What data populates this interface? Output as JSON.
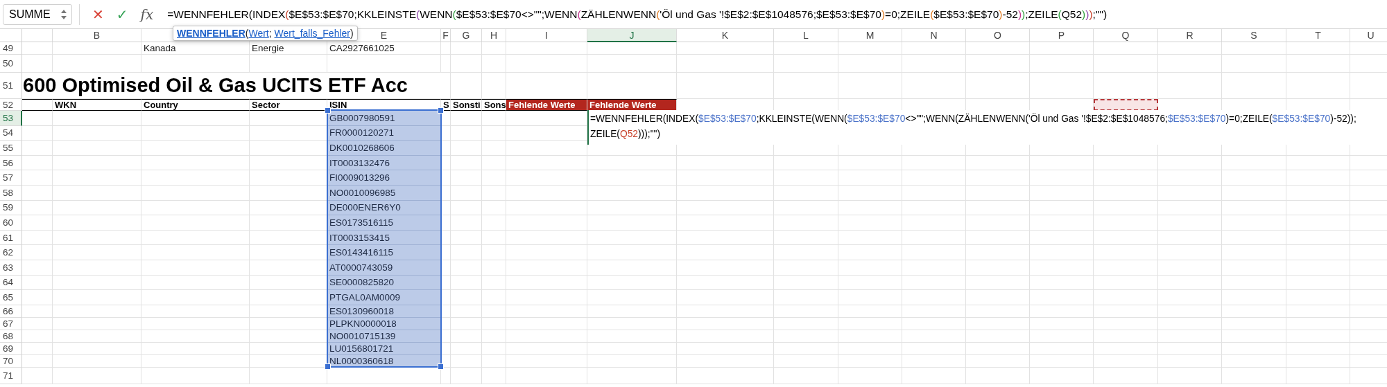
{
  "name_box": {
    "value": "SUMME"
  },
  "formula_bar": {
    "cancel": "✕",
    "confirm": "✓",
    "function_button": "fx",
    "segments": [
      {
        "text": "=WENNFEHLER(INDEX",
        "color": "#000000"
      },
      {
        "text": "(",
        "color": "#c8412a"
      },
      {
        "text": "$E$53:$E$70;KKLEINSTE",
        "color": "#000000"
      },
      {
        "text": "(",
        "color": "#8e44ad"
      },
      {
        "text": "WENN",
        "color": "#000000"
      },
      {
        "text": "(",
        "color": "#2e9e3e"
      },
      {
        "text": "$E$53:$E$70<>\"\";WENN",
        "color": "#000000"
      },
      {
        "text": "(",
        "color": "#c2338f"
      },
      {
        "text": "ZÄHLENWENN",
        "color": "#000000"
      },
      {
        "text": "(",
        "color": "#e07b22"
      },
      {
        "text": "'Öl und Gas '!$E$2:$E$1048576;$E$53:$E$70",
        "color": "#000000"
      },
      {
        "text": ")",
        "color": "#e07b22"
      },
      {
        "text": "=0;ZEILE",
        "color": "#000000"
      },
      {
        "text": "(",
        "color": "#e07b22"
      },
      {
        "text": "$E$53:$E$70",
        "color": "#000000"
      },
      {
        "text": ")",
        "color": "#e07b22"
      },
      {
        "text": "-52",
        "color": "#000000"
      },
      {
        "text": ")",
        "color": "#c2338f"
      },
      {
        "text": ")",
        "color": "#2e9e3e"
      },
      {
        "text": ";ZEILE",
        "color": "#000000"
      },
      {
        "text": "(",
        "color": "#2e9e3e"
      },
      {
        "text": "Q52",
        "color": "#000000"
      },
      {
        "text": ")",
        "color": "#2e9e3e"
      },
      {
        "text": ")",
        "color": "#8e44ad"
      },
      {
        "text": ")",
        "color": "#c8412a"
      },
      {
        "text": ";\"\")",
        "color": "#000000"
      }
    ]
  },
  "tooltip": {
    "function": "WENNFEHLER",
    "open": "(",
    "args": [
      "Wert",
      "Wert_falls_Fehler"
    ],
    "separator": "; ",
    "close": ")"
  },
  "column_headers": [
    {
      "label": "B",
      "selected": false
    },
    {
      "selected": false
    },
    {
      "selected": false
    },
    {
      "label": "E",
      "selected": false
    },
    {
      "label": "F",
      "selected": false
    },
    {
      "label": "G",
      "selected": false
    },
    {
      "label": "H",
      "selected": false
    },
    {
      "label": "I",
      "selected": false
    },
    {
      "label": "J",
      "selected": true
    },
    {
      "label": "K",
      "selected": false
    },
    {
      "label": "L",
      "selected": false
    },
    {
      "label": "M",
      "selected": false
    },
    {
      "label": "N",
      "selected": false
    },
    {
      "label": "O",
      "selected": false
    },
    {
      "label": "P",
      "selected": false
    },
    {
      "label": "Q",
      "selected": false
    },
    {
      "label": "R",
      "selected": false
    },
    {
      "label": "S",
      "selected": false
    },
    {
      "label": "T",
      "selected": false
    },
    {
      "label": "U",
      "selected": false
    }
  ],
  "rows": [
    {
      "number": "49",
      "selected": false,
      "cells": {
        "c": {
          "text": "Kanada"
        },
        "d": {
          "text": "Energie"
        },
        "e": {
          "text": "CA2927661025"
        }
      }
    },
    {
      "number": "50",
      "selected": false,
      "cells": {}
    },
    {
      "number": "51",
      "selected": false,
      "cells": {
        "a": {
          "text": "600 Optimised Oil & Gas UCITS ETF Acc",
          "kind": "title"
        }
      }
    },
    {
      "number": "52",
      "selected": false,
      "cells": {
        "b": {
          "text": "WKN",
          "kind": "header"
        },
        "c": {
          "text": "Country",
          "kind": "header"
        },
        "d": {
          "text": "Sector",
          "kind": "header"
        },
        "e": {
          "text": "ISIN",
          "kind": "header"
        },
        "f": {
          "text": "S",
          "kind": "header"
        },
        "g": {
          "text": "Sonsti",
          "kind": "header"
        },
        "h": {
          "text": "Sons",
          "kind": "header"
        },
        "i": {
          "text": "Fehlende Werte",
          "kind": "missing"
        },
        "j": {
          "text": "Fehlende Werte",
          "kind": "missing"
        },
        "q": {
          "kind": "copy-range"
        }
      }
    },
    {
      "number": "53",
      "selected": true,
      "cells": {
        "e": {
          "text": "GB0007980591",
          "selected": true
        }
      }
    },
    {
      "number": "54",
      "selected": false,
      "cells": {
        "e": {
          "text": "FR0000120271",
          "selected": true
        }
      }
    },
    {
      "number": "55",
      "selected": false,
      "cells": {
        "e": {
          "text": "DK0010268606",
          "selected": true
        }
      }
    },
    {
      "number": "56",
      "selected": false,
      "cells": {
        "e": {
          "text": "IT0003132476",
          "selected": true
        }
      }
    },
    {
      "number": "57",
      "selected": false,
      "cells": {
        "e": {
          "text": "FI0009013296",
          "selected": true
        }
      }
    },
    {
      "number": "58",
      "selected": false,
      "cells": {
        "e": {
          "text": "NO0010096985",
          "selected": true
        }
      }
    },
    {
      "number": "59",
      "selected": false,
      "cells": {
        "e": {
          "text": "DE000ENER6Y0",
          "selected": true
        }
      }
    },
    {
      "number": "60",
      "selected": false,
      "cells": {
        "e": {
          "text": "ES0173516115",
          "selected": true
        }
      }
    },
    {
      "number": "61",
      "selected": false,
      "cells": {
        "e": {
          "text": "IT0003153415",
          "selected": true
        }
      }
    },
    {
      "number": "62",
      "selected": false,
      "cells": {
        "e": {
          "text": "ES0143416115",
          "selected": true
        }
      }
    },
    {
      "number": "63",
      "selected": false,
      "cells": {
        "e": {
          "text": "AT0000743059",
          "selected": true
        }
      }
    },
    {
      "number": "64",
      "selected": false,
      "cells": {
        "e": {
          "text": "SE0000825820",
          "selected": true
        }
      }
    },
    {
      "number": "65",
      "selected": false,
      "cells": {
        "e": {
          "text": "PTGAL0AM0009",
          "selected": true
        }
      }
    },
    {
      "number": "66",
      "selected": false,
      "cells": {
        "e": {
          "text": "ES0130960018",
          "selected": true
        }
      }
    },
    {
      "number": "67",
      "selected": false,
      "cells": {
        "e": {
          "text": "PLPKN0000018",
          "selected": true
        }
      }
    },
    {
      "number": "68",
      "selected": false,
      "cells": {
        "e": {
          "text": "NO0010715139",
          "selected": true
        }
      }
    },
    {
      "number": "69",
      "selected": false,
      "cells": {
        "e": {
          "text": "LU0156801721",
          "selected": true
        }
      }
    },
    {
      "number": "70",
      "selected": false,
      "cells": {
        "e": {
          "text": "NL0000360618",
          "selected": true
        }
      }
    },
    {
      "number": "71",
      "selected": false,
      "cells": {}
    }
  ],
  "cell_editor": {
    "lines": [
      [
        {
          "text": "=WENNFEHLER(INDEX(",
          "color": "#000000"
        },
        {
          "text": "$E$53:$E$70",
          "color": "#4a72c9"
        },
        {
          "text": ";KKLEINSTE(WENN(",
          "color": "#000000"
        },
        {
          "text": "$E$53:$E$70",
          "color": "#4a72c9"
        },
        {
          "text": "<>\"\";WENN(ZÄHLENWENN('Öl und Gas '!$E$2:$E$1048576;",
          "color": "#000000"
        },
        {
          "text": "$E$53:$E$70",
          "color": "#4a72c9"
        },
        {
          "text": ")=0;ZEILE(",
          "color": "#000000"
        },
        {
          "text": "$E$53:$E$70",
          "color": "#4a72c9"
        },
        {
          "text": ")-52));",
          "color": "#000000"
        }
      ],
      [
        {
          "text": "ZEILE(",
          "color": "#000000"
        },
        {
          "text": "Q52",
          "color": "#c8412a"
        },
        {
          "text": ")));\"\")",
          "color": "#000000"
        }
      ]
    ]
  }
}
